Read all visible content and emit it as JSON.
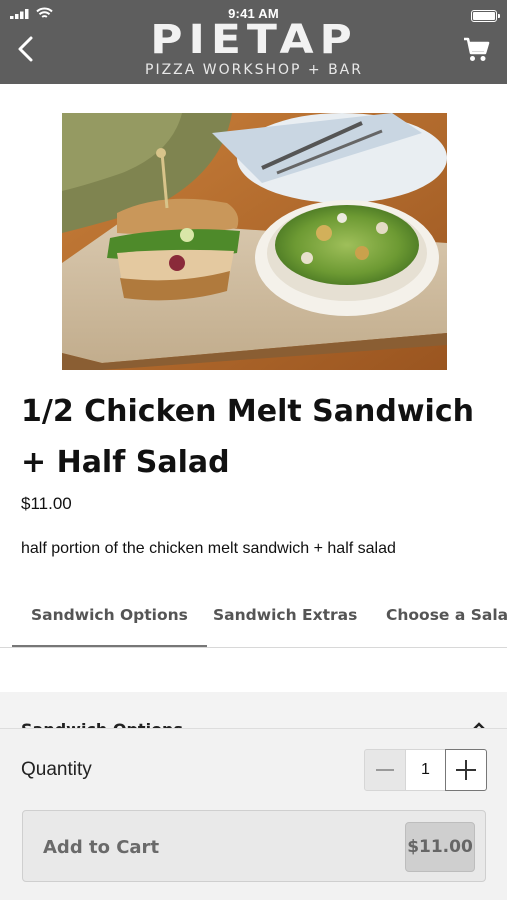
{
  "status_bar": {
    "time": "9:41 AM"
  },
  "header": {
    "brand": "PIETAP",
    "tagline": "PIZZA WORKSHOP + BAR",
    "back_icon": "chevron-left-icon",
    "cart_icon": "shopping-cart-icon"
  },
  "product": {
    "title": "1/2 Chicken Melt Sandwich + Half Salad",
    "price": "$11.00",
    "description": "half portion of the chicken melt sandwich + half salad"
  },
  "tabs": [
    {
      "label": "Sandwich Options",
      "active": true
    },
    {
      "label": "Sandwich Extras",
      "active": false
    },
    {
      "label": "Choose a Sala",
      "active": false
    }
  ],
  "options_section": {
    "title": "Sandwich Options",
    "icon": "chevron-up-icon"
  },
  "cart_sheet": {
    "quantity_label": "Quantity",
    "quantity": "1",
    "minus_icon": "minus-icon",
    "plus_icon": "plus-icon",
    "add_label": "Add to Cart",
    "add_price": "$11.00"
  },
  "colors": {
    "header_bg": "#5e5e5e",
    "sheet_bg": "#f2f2f2",
    "tab_indicator": "#777777"
  }
}
